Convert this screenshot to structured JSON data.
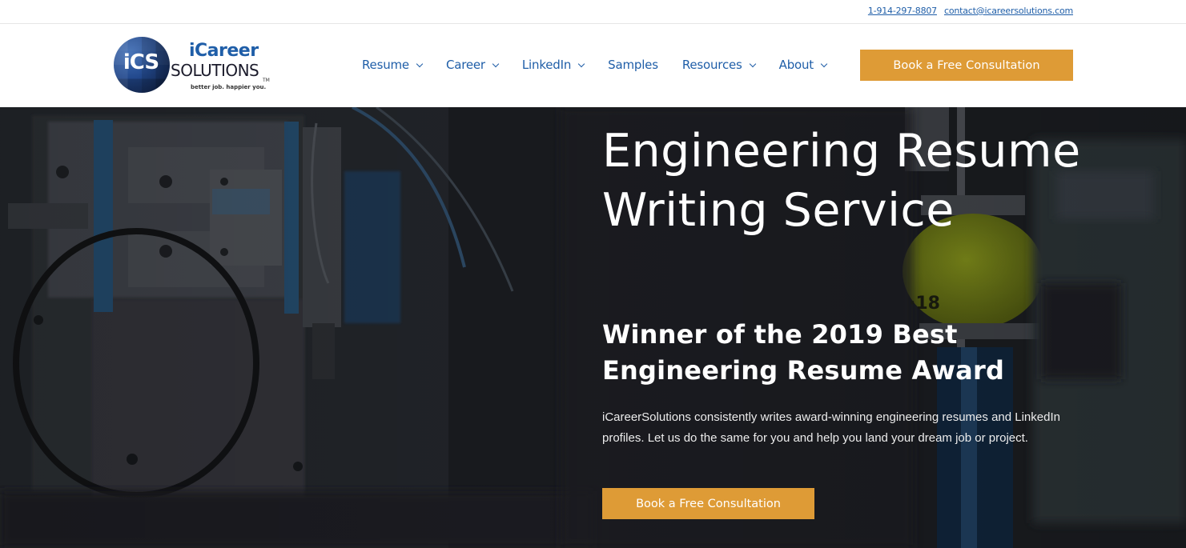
{
  "topbar": {
    "phone": "1-914-297-8807",
    "email": "contact@icareersolutions.com"
  },
  "logo": {
    "mark": "iCS",
    "name_top": "iCareer",
    "name_bottom": "SOLUTIONS",
    "trademark": "TM",
    "tagline": "better job. happier you."
  },
  "nav": {
    "items": [
      {
        "label": "Resume",
        "has_dropdown": true,
        "icon": "chevron-down-icon"
      },
      {
        "label": "Career",
        "has_dropdown": true,
        "icon": "chevron-down-icon"
      },
      {
        "label": "LinkedIn",
        "has_dropdown": true,
        "icon": "chevron-down-icon"
      },
      {
        "label": "Samples",
        "has_dropdown": false
      },
      {
        "label": "Resources",
        "has_dropdown": true,
        "icon": "chevron-down-icon"
      },
      {
        "label": "About",
        "has_dropdown": true,
        "icon": "chevron-down-icon"
      }
    ],
    "cta_label": "Book a Free Consultation"
  },
  "hero": {
    "title": "Engineering Resume Writing Service",
    "subtitle": "Winner of the 2019 Best Engineering Resume Award",
    "body": "iCareerSolutions consistently writes award-winning engineering resumes and LinkedIn profiles. Let us do the same for you and help you land your dream job or project.",
    "cta_label": "Book a Free Consultation",
    "image_description": "Dark photo of engineering machinery with blue pneumatic actuator and yellow ball"
  },
  "colors": {
    "brand_blue": "#1f5ea8",
    "accent_orange": "#de9b36",
    "hero_text": "#ffffff"
  }
}
